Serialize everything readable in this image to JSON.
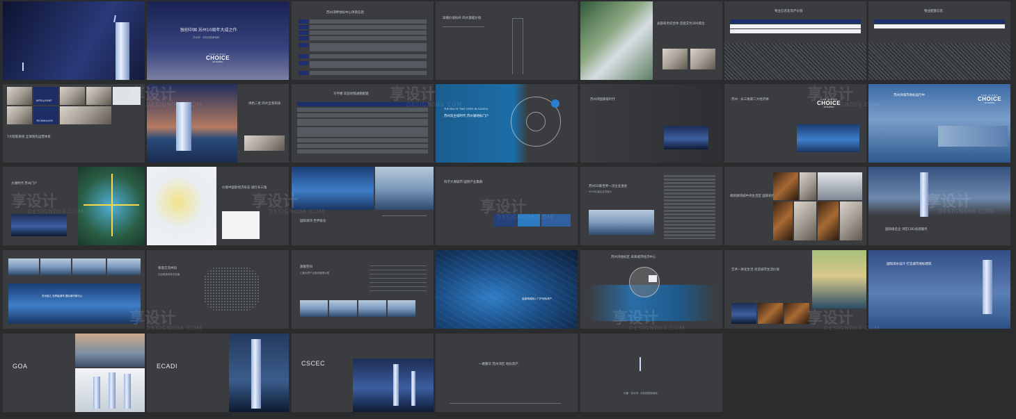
{
  "slides": {
    "s01": {
      "caption": ""
    },
    "s02": {
      "title": "独创中国 苏州10周年大成之作",
      "subtitle": "苏州湾 · 天际线首席地标",
      "logo_top": "THE FIRST",
      "logo_mid": "CHOICE",
      "logo_bot": "OF SUZHOU"
    },
    "s03": {
      "title": "苏州湾畔地标中心项目信息"
    },
    "s04": {
      "title": "高端价值标杆 四大基础价值"
    },
    "s05": {
      "title": "总部商务综合体 首批交付300席位"
    },
    "s06": {
      "title": "物业信息及资产价值"
    },
    "s07": {
      "title": "物业配套信息"
    },
    "s08": {
      "label1": "INTELLIGENT",
      "label2": "TECHNOLOGY",
      "caption": "7大智能系统 全球领先运营体系"
    },
    "s09": {
      "title": "绿色二星 四大全系科技"
    },
    "s10": {
      "title": "写字楼 双层地铁通勤配套"
    },
    "s11": {
      "en": "THE ERA OF TWO CITIES IN SUZHOU",
      "title": "苏州双主城时代 苏州湖地标门户"
    },
    "s12": {
      "title": "苏州湾国家级时代"
    },
    "s13": {
      "title": "苏州 · 长三角第二大经济体",
      "logo_top": "THE FIRST",
      "logo_mid": "CHOICE",
      "logo_bot": "OF SUZHOU"
    },
    "s14": {
      "title": "苏州湾城市地标运行中",
      "logo_top": "THE FIRST",
      "logo_mid": "CHOICE",
      "logo_bot": "OF SUZHOU"
    },
    "s15": {
      "title": "大湖时代 苏州门户"
    },
    "s16": {
      "title": "价值中国新经济形态 城行长三角"
    },
    "s17": {
      "caption": "国际湖湾 世界级化"
    },
    "s18": {
      "title": "科学大湖城市 国际产业集群"
    },
    "s19": {
      "title": "苏州50家世界一流企业进驻",
      "subtitle": "5000亿级企业总部人"
    },
    "s20": {
      "title": "规划湖湾城中央生活区 国际商务湾区"
    },
    "s21": {
      "title": "国际级名企 湾区CBD总部服务"
    },
    "s22": {
      "caption": "苏州吴江 世界级湖湾 国际城市新中心"
    },
    "s23": {
      "title": "和谐交流共同",
      "subtitle": "共赢精英商务在此聚"
    },
    "s24": {
      "title": "旗舰空间",
      "subtitle": "汇聚世界产业融资管理大楼"
    },
    "s25": {
      "caption": "高速湾城核心 门户地标资产"
    },
    "s26": {
      "title": "苏州湾地标区 未来城市经济中心"
    },
    "s27": {
      "title": "艺术一体化生活 创造城市生活价值"
    },
    "s28": {
      "title": "国际滨水设计 打造城市地标建筑"
    },
    "s29": {
      "brand": "GOA"
    },
    "s30": {
      "brand": "ECADI"
    },
    "s31": {
      "brand": "CSCEC"
    },
    "s32": {
      "caption": "一路繁华 苏州湾区 地标资产"
    },
    "s33": {
      "caption": "中建 · 苏州湾 · 天际线首席地标"
    }
  },
  "watermark": {
    "cn": "享设计",
    "en": "DESIGN006.COM"
  }
}
